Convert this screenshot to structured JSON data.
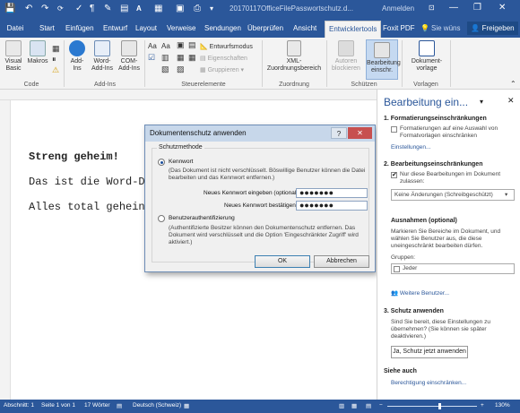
{
  "titlebar": {
    "title": "20170117OfficeFilePasswortschutz.d...",
    "login": "Anmelden",
    "minimize": "—",
    "restore": "❐",
    "close": "✕"
  },
  "tabs": {
    "file": "Datei",
    "items": [
      "Start",
      "Einfügen",
      "Entwurf",
      "Layout",
      "Verweise",
      "Sendungen",
      "Überprüfen",
      "Ansicht",
      "Entwicklertools",
      "Foxit PDF"
    ],
    "search": "Sie wüns",
    "share": "Freigeben"
  },
  "ribbon": {
    "code": {
      "visual_basic": "Visual Basic",
      "macros": "Makros",
      "group": "Code"
    },
    "addins": {
      "addins": "Add-Ins",
      "word_addins": "Word-Add-Ins",
      "com_addins": "COM-Add-Ins",
      "group": "Add-Ins"
    },
    "controls": {
      "design_mode": "Entwurfsmodus",
      "properties": "Eigenschaften",
      "group_btn": "Gruppieren",
      "group": "Steuerelemente"
    },
    "mapping": {
      "xml": "XML-Zuordnungsbereich",
      "group": "Zuordnung"
    },
    "protect": {
      "block": "Autoren blockieren",
      "restrict": "Bearbeitung einschr.",
      "group": "Schützen"
    },
    "templates": {
      "doc_template": "Dokument-vorlage",
      "group": "Vorlagen"
    }
  },
  "document": {
    "line1": "Streng geheim!",
    "line2": "Das ist die Word-D",
    "line3": "Alles total gehein"
  },
  "dialog": {
    "title": "Dokumentenschutz anwenden",
    "help": "?",
    "close": "✕",
    "group_label": "Schutzmethode",
    "password_label": "Kennwort",
    "password_desc": "(Das Dokument ist nicht verschlüsselt. Böswillige Benutzer können die Datei bearbeiten und das Kennwort entfernen.)",
    "new_password_label": "Neues Kennwort eingeben (optional):",
    "new_password_value": "●●●●●●●",
    "confirm_label": "Neues Kennwort bestätigen:",
    "confirm_value": "●●●●●●●",
    "user_auth_label": "Benutzerauthentifizierung",
    "user_auth_desc": "(Authentifizierte Besitzer können den Dokumentenschutz entfernen. Das Dokument wird verschlüsselt und die Option 'Eingeschränkter Zugriff' wird aktiviert.)",
    "ok": "OK",
    "cancel": "Abbrechen"
  },
  "pane": {
    "title": "Bearbeitung ein...",
    "section1": "1. Formatierungseinschränkungen",
    "s1_check": "Formatierungen auf eine Auswahl von Formatvorlagen einschränken",
    "s1_link": "Einstellungen...",
    "section2": "2. Bearbeitungseinschränkungen",
    "s2_check": "Nur diese Bearbeitungen im Dokument zulassen:",
    "s2_select": "Keine Änderungen (Schreibgeschützt)",
    "exceptions": "Ausnahmen (optional)",
    "exceptions_desc": "Markieren Sie Bereiche im Dokument, und wählen Sie Benutzer aus, die diese uneingeschränkt bearbeiten dürfen.",
    "groups_label": "Gruppen:",
    "group_item": "Jeder",
    "more_users": "Weitere Benutzer...",
    "section3": "3. Schutz anwenden",
    "s3_desc": "Sind Sie bereit, diese Einstellungen zu übernehmen? (Sie können sie später deaktivieren.)",
    "s3_button": "Ja, Schutz jetzt anwenden",
    "see_also": "Siehe auch",
    "see_also_link": "Berechtigung einschränken..."
  },
  "statusbar": {
    "section": "Abschnitt: 1",
    "page": "Seite 1 von 1",
    "words": "17 Wörter",
    "lang": "Deutsch (Schweiz)",
    "zoom": "130%"
  },
  "colors": {
    "brand": "#2b579a",
    "accent_dark": "#1e4a85"
  }
}
